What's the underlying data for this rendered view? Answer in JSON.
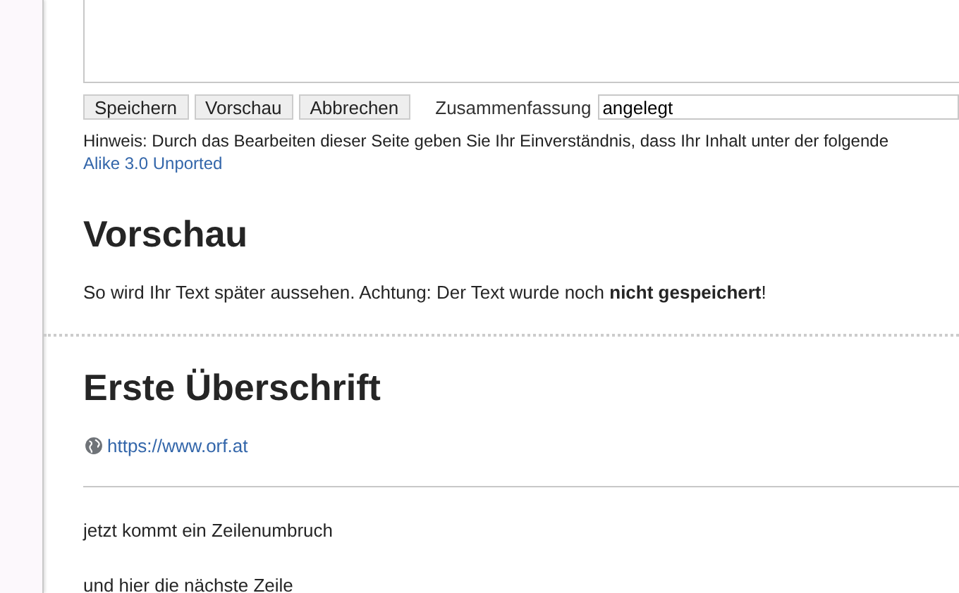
{
  "edit_buttons": [
    {
      "label": "Speichern"
    },
    {
      "label": "Vorschau"
    },
    {
      "label": "Abbrechen"
    }
  ],
  "summary": {
    "label": "Zusammenfassung",
    "value": "angelegt"
  },
  "notice": "Hinweis: Durch das Bearbeiten dieser Seite geben Sie Ihr Einverständnis, dass Ihr Inhalt unter der folgende",
  "license_link": "Alike 3.0 Unported",
  "preview": {
    "heading": "Vorschau",
    "note": "So wird Ihr Text später aussehen. Achtung: Der Text wurde noch **nicht gespeichert**!"
  },
  "content": {
    "heading": "Erste Überschrift",
    "link": "https://www.orf.at",
    "paragraphs": [
      "jetzt kommt ein Zeilenumbruch",
      "und hier die nächste Zeile"
    ]
  }
}
